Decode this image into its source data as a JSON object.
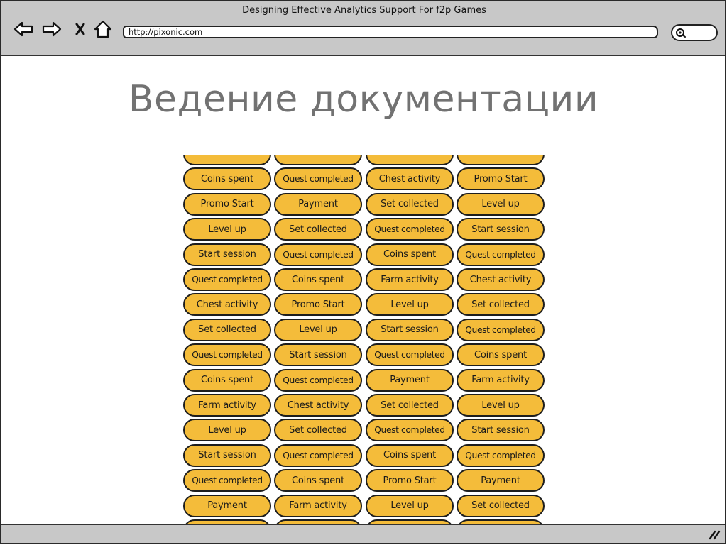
{
  "window": {
    "title": "Designing Effective Analytics Support For f2p Games",
    "url": "http://pixonic.com"
  },
  "toolbar": {
    "back_icon": "left-arrow-icon",
    "forward_icon": "right-arrow-icon",
    "stop_icon": "close-icon",
    "home_icon": "home-icon",
    "search_icon": "search-icon"
  },
  "slide": {
    "title": "Ведение документации"
  },
  "colors": {
    "pill_fill": "#f4bc3a",
    "pill_border": "#1e1e1e",
    "chrome_bg": "#c8c8c8",
    "title_text": "#727272"
  },
  "event_grid": {
    "rows": [
      [
        "",
        "",
        "",
        ""
      ],
      [
        "Coins spent",
        "Quest completed",
        "Chest activity",
        "Promo Start"
      ],
      [
        "Promo Start",
        "Payment",
        "Set collected",
        "Level up"
      ],
      [
        "Level up",
        "Set collected",
        "Quest completed",
        "Start session"
      ],
      [
        "Start session",
        "Quest completed",
        "Coins spent",
        "Quest completed"
      ],
      [
        "Quest completed",
        "Coins spent",
        "Farm activity",
        "Chest activity"
      ],
      [
        "Chest activity",
        "Promo Start",
        "Level up",
        "Set collected"
      ],
      [
        "Set collected",
        "Level up",
        "Start session",
        "Quest completed"
      ],
      [
        "Quest completed",
        "Start session",
        "Quest completed",
        "Coins spent"
      ],
      [
        "Coins spent",
        "Quest completed",
        "Payment",
        "Farm activity"
      ],
      [
        "Farm activity",
        "Chest activity",
        "Set collected",
        "Level up"
      ],
      [
        "Level up",
        "Set collected",
        "Quest completed",
        "Start session"
      ],
      [
        "Start session",
        "Quest completed",
        "Coins spent",
        "Quest completed"
      ],
      [
        "Quest completed",
        "Coins spent",
        "Promo Start",
        "Payment"
      ],
      [
        "Payment",
        "Farm activity",
        "Level up",
        "Set collected"
      ],
      [
        "",
        "",
        "",
        ""
      ]
    ]
  }
}
